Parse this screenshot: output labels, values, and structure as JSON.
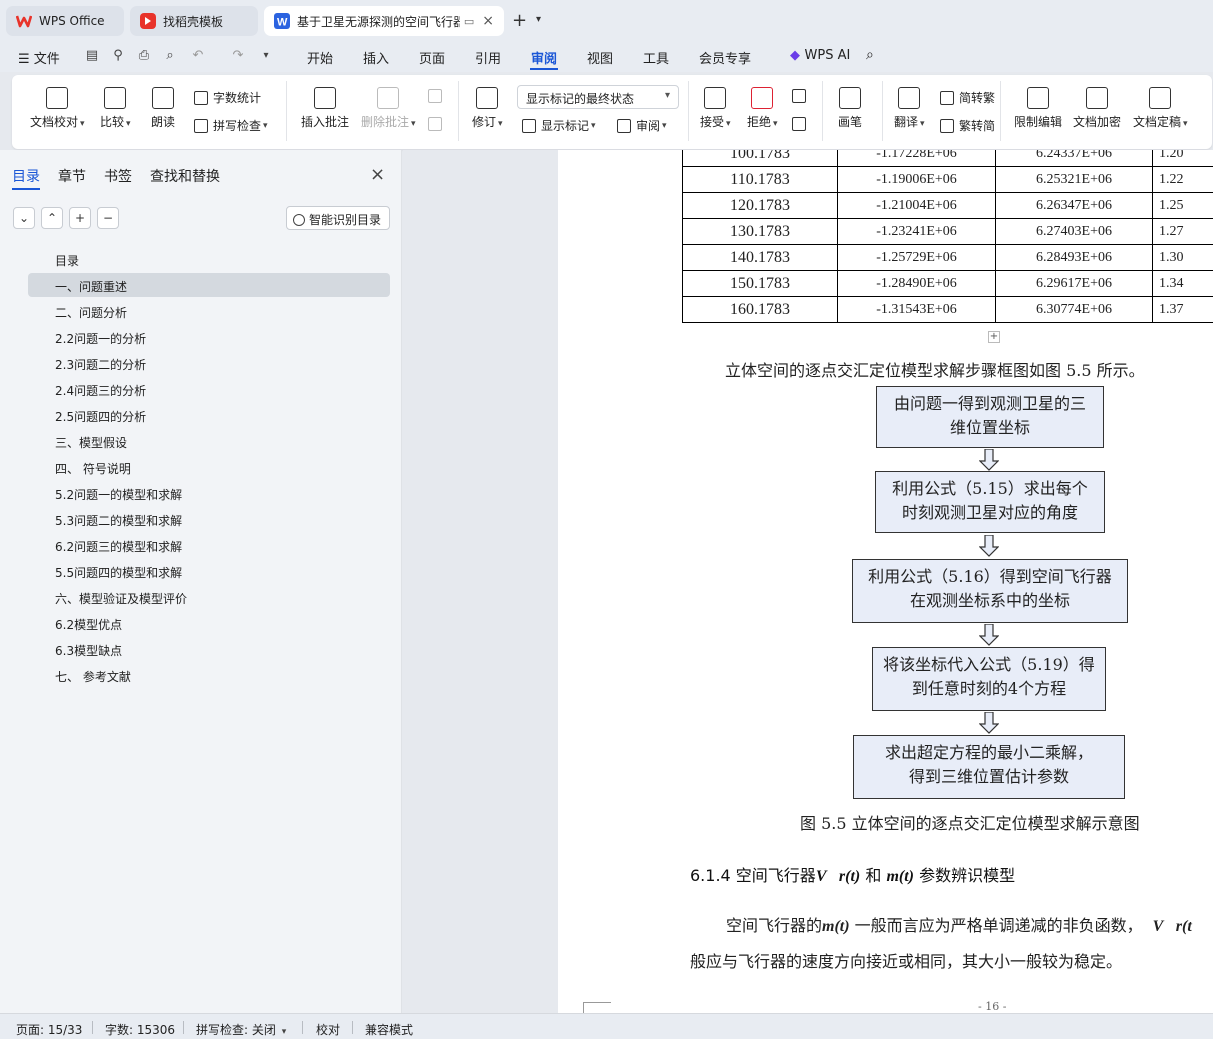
{
  "tabs": [
    {
      "label": "WPS Office",
      "icon": "wps-logo-icon"
    },
    {
      "label": "找稻壳模板",
      "icon": "docer-icon"
    },
    {
      "label": "基于卫星无源探测的空间飞行器",
      "icon": "word-doc-icon",
      "active": true
    }
  ],
  "menu": {
    "file": "文件",
    "items": [
      "开始",
      "插入",
      "页面",
      "引用",
      "审阅",
      "视图",
      "工具",
      "会员专享"
    ],
    "active": "审阅",
    "ai": "WPS AI"
  },
  "ribbon": {
    "doc_proof": "文档校对",
    "compare": "比较",
    "read_aloud": "朗读",
    "word_count": "字数统计",
    "spell_check": "拼写检查",
    "insert_comment": "插入批注",
    "delete_comment": "删除批注",
    "track": "修订",
    "markup_select": "显示标记的最终状态",
    "show_markup": "显示标记",
    "review": "审阅",
    "accept": "接受",
    "reject": "拒绝",
    "pen": "画笔",
    "translate": "翻译",
    "to_traditional": "简转繁",
    "to_simplified": "繁转简",
    "restrict_edit": "限制编辑",
    "doc_encrypt": "文档加密",
    "doc_finalize": "文档定稿"
  },
  "leftpanel": {
    "tabs": [
      "目录",
      "章节",
      "书签",
      "查找和替换"
    ],
    "smart_toc": "智能识别目录",
    "toc": [
      "目录",
      "一、问题重述",
      "二、问题分析",
      "2.2问题一的分析",
      "2.3问题二的分析",
      "2.4问题三的分析",
      "2.5问题四的分析",
      "三、模型假设",
      "四、 符号说明",
      "5.2问题一的模型和求解",
      "5.3问题二的模型和求解",
      "6.2问题三的模型和求解",
      "5.5问题四的模型和求解",
      "六、模型验证及模型评价",
      "6.2模型优点",
      "6.3模型缺点",
      "七、 参考文献"
    ],
    "selected": "一、问题重述"
  },
  "document": {
    "table_rows": [
      [
        "100.1783",
        "-1.17228E+06",
        "6.24337E+06",
        "1.20"
      ],
      [
        "110.1783",
        "-1.19006E+06",
        "6.25321E+06",
        "1.22"
      ],
      [
        "120.1783",
        "-1.21004E+06",
        "6.26347E+06",
        "1.25"
      ],
      [
        "130.1783",
        "-1.23241E+06",
        "6.27403E+06",
        "1.27"
      ],
      [
        "140.1783",
        "-1.25729E+06",
        "6.28493E+06",
        "1.30"
      ],
      [
        "150.1783",
        "-1.28490E+06",
        "6.29617E+06",
        "1.34"
      ],
      [
        "160.1783",
        "-1.31543E+06",
        "6.30774E+06",
        "1.37"
      ]
    ],
    "intro": "立体空间的逐点交汇定位模型求解步骤框图如图 5.5 所示。",
    "flow": [
      [
        "由问题一得到观测卫星的三",
        "维位置坐标"
      ],
      [
        "利用公式（5.15）求出每个",
        "时刻观测卫星对应的角度"
      ],
      [
        "利用公式（5.16）得到空间飞行器",
        "在观测坐标系中的坐标"
      ],
      [
        "将该坐标代入公式（5.19）得",
        "到任意时刻的4个方程"
      ],
      [
        "求出超定方程的最小二乘解，",
        "得到三维位置估计参数"
      ]
    ],
    "caption": "图 5.5   立体空间的逐点交汇定位模型求解示意图",
    "heading_pre": "6.1.4 空间飞行器",
    "heading_sym1": "V⃗r(t)",
    "heading_mid": " 和 ",
    "heading_sym2": "m(t)",
    "heading_post": " 参数辨识模型",
    "p1_pre": "空间飞行器的",
    "p1_sym": "m(t)",
    "p1_post": " 一般而言应为严格单调递减的非负函数，",
    "p1_tail": "V⃗r(t",
    "p2": "般应与飞行器的速度方向接近或相同，其大小一般较为稳定。",
    "page_num": "- 16 -"
  },
  "statusbar": {
    "page": "页面: 15/33",
    "words": "字数: 15306",
    "spell": "拼写检查: 关闭",
    "proof": "校对",
    "compat": "兼容模式"
  },
  "colors": {
    "accent": "#1a56d6",
    "wps_red": "#e8332a",
    "flow_fill": "#e8edf8"
  }
}
